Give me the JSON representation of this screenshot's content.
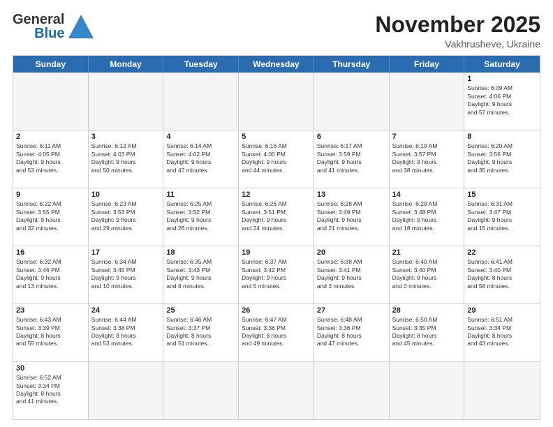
{
  "header": {
    "logo_general": "General",
    "logo_blue": "Blue",
    "month_year": "November 2025",
    "location": "Vakhrusheve, Ukraine"
  },
  "weekdays": [
    "Sunday",
    "Monday",
    "Tuesday",
    "Wednesday",
    "Thursday",
    "Friday",
    "Saturday"
  ],
  "rows": [
    [
      {
        "day": "",
        "info": ""
      },
      {
        "day": "",
        "info": ""
      },
      {
        "day": "",
        "info": ""
      },
      {
        "day": "",
        "info": ""
      },
      {
        "day": "",
        "info": ""
      },
      {
        "day": "",
        "info": ""
      },
      {
        "day": "1",
        "info": "Sunrise: 6:09 AM\nSunset: 4:06 PM\nDaylight: 9 hours\nand 57 minutes."
      }
    ],
    [
      {
        "day": "2",
        "info": "Sunrise: 6:11 AM\nSunset: 4:05 PM\nDaylight: 9 hours\nand 53 minutes."
      },
      {
        "day": "3",
        "info": "Sunrise: 6:12 AM\nSunset: 4:03 PM\nDaylight: 9 hours\nand 50 minutes."
      },
      {
        "day": "4",
        "info": "Sunrise: 6:14 AM\nSunset: 4:02 PM\nDaylight: 9 hours\nand 47 minutes."
      },
      {
        "day": "5",
        "info": "Sunrise: 6:16 AM\nSunset: 4:00 PM\nDaylight: 9 hours\nand 44 minutes."
      },
      {
        "day": "6",
        "info": "Sunrise: 6:17 AM\nSunset: 3:59 PM\nDaylight: 9 hours\nand 41 minutes."
      },
      {
        "day": "7",
        "info": "Sunrise: 6:19 AM\nSunset: 3:57 PM\nDaylight: 9 hours\nand 38 minutes."
      },
      {
        "day": "8",
        "info": "Sunrise: 6:20 AM\nSunset: 3:56 PM\nDaylight: 9 hours\nand 35 minutes."
      }
    ],
    [
      {
        "day": "9",
        "info": "Sunrise: 6:22 AM\nSunset: 3:55 PM\nDaylight: 9 hours\nand 32 minutes."
      },
      {
        "day": "10",
        "info": "Sunrise: 6:23 AM\nSunset: 3:53 PM\nDaylight: 9 hours\nand 29 minutes."
      },
      {
        "day": "11",
        "info": "Sunrise: 6:25 AM\nSunset: 3:52 PM\nDaylight: 9 hours\nand 26 minutes."
      },
      {
        "day": "12",
        "info": "Sunrise: 6:26 AM\nSunset: 3:51 PM\nDaylight: 9 hours\nand 24 minutes."
      },
      {
        "day": "13",
        "info": "Sunrise: 6:28 AM\nSunset: 3:49 PM\nDaylight: 9 hours\nand 21 minutes."
      },
      {
        "day": "14",
        "info": "Sunrise: 6:29 AM\nSunset: 3:48 PM\nDaylight: 9 hours\nand 18 minutes."
      },
      {
        "day": "15",
        "info": "Sunrise: 6:31 AM\nSunset: 3:47 PM\nDaylight: 9 hours\nand 15 minutes."
      }
    ],
    [
      {
        "day": "16",
        "info": "Sunrise: 6:32 AM\nSunset: 3:46 PM\nDaylight: 9 hours\nand 13 minutes."
      },
      {
        "day": "17",
        "info": "Sunrise: 6:34 AM\nSunset: 3:45 PM\nDaylight: 9 hours\nand 10 minutes."
      },
      {
        "day": "18",
        "info": "Sunrise: 6:35 AM\nSunset: 3:43 PM\nDaylight: 9 hours\nand 8 minutes."
      },
      {
        "day": "19",
        "info": "Sunrise: 6:37 AM\nSunset: 3:42 PM\nDaylight: 9 hours\nand 5 minutes."
      },
      {
        "day": "20",
        "info": "Sunrise: 6:38 AM\nSunset: 3:41 PM\nDaylight: 9 hours\nand 3 minutes."
      },
      {
        "day": "21",
        "info": "Sunrise: 6:40 AM\nSunset: 3:40 PM\nDaylight: 9 hours\nand 0 minutes."
      },
      {
        "day": "22",
        "info": "Sunrise: 6:41 AM\nSunset: 3:40 PM\nDaylight: 8 hours\nand 58 minutes."
      }
    ],
    [
      {
        "day": "23",
        "info": "Sunrise: 6:43 AM\nSunset: 3:39 PM\nDaylight: 8 hours\nand 55 minutes."
      },
      {
        "day": "24",
        "info": "Sunrise: 6:44 AM\nSunset: 3:38 PM\nDaylight: 8 hours\nand 53 minutes."
      },
      {
        "day": "25",
        "info": "Sunrise: 6:46 AM\nSunset: 3:37 PM\nDaylight: 8 hours\nand 51 minutes."
      },
      {
        "day": "26",
        "info": "Sunrise: 6:47 AM\nSunset: 3:36 PM\nDaylight: 8 hours\nand 49 minutes."
      },
      {
        "day": "27",
        "info": "Sunrise: 6:48 AM\nSunset: 3:36 PM\nDaylight: 8 hours\nand 47 minutes."
      },
      {
        "day": "28",
        "info": "Sunrise: 6:50 AM\nSunset: 3:35 PM\nDaylight: 8 hours\nand 45 minutes."
      },
      {
        "day": "29",
        "info": "Sunrise: 6:51 AM\nSunset: 3:34 PM\nDaylight: 8 hours\nand 43 minutes."
      }
    ],
    [
      {
        "day": "30",
        "info": "Sunrise: 6:52 AM\nSunset: 3:34 PM\nDaylight: 8 hours\nand 41 minutes."
      },
      {
        "day": "",
        "info": ""
      },
      {
        "day": "",
        "info": ""
      },
      {
        "day": "",
        "info": ""
      },
      {
        "day": "",
        "info": ""
      },
      {
        "day": "",
        "info": ""
      },
      {
        "day": "",
        "info": ""
      }
    ]
  ]
}
